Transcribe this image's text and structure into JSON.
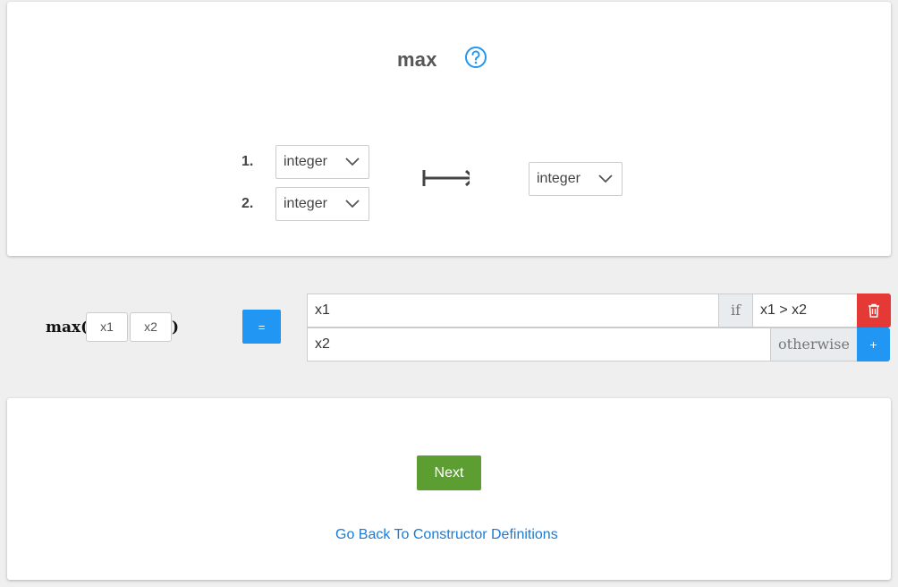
{
  "function": {
    "name": "max",
    "help_icon": "question-circle-icon"
  },
  "signature": {
    "args": [
      {
        "number": "1.",
        "type": "integer"
      },
      {
        "number": "2.",
        "type": "integer"
      }
    ],
    "arrow_icon": "maps-to-arrow-icon",
    "return_type": "integer"
  },
  "definition": {
    "name": "max(",
    "close_paren": ")",
    "params": [
      "x1",
      "x2"
    ],
    "equals_label": "=",
    "cases": [
      {
        "expression": "x1",
        "keyword": "if",
        "condition": "x1 > x2",
        "action_icon": "trash-icon"
      },
      {
        "expression": "x2",
        "keyword": "otherwise",
        "action_label": "+"
      }
    ]
  },
  "footer": {
    "next_label": "Next",
    "back_link": "Go Back To Constructor Definitions"
  },
  "colors": {
    "primary": "#2196f3",
    "danger": "#e53935",
    "success": "#5c9e31",
    "link": "#1a7bd6"
  }
}
